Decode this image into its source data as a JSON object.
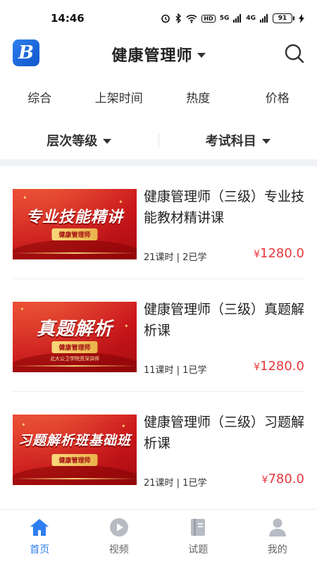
{
  "status_bar": {
    "time": "14:46",
    "hd_label": "HD",
    "signal_label_1": "5G",
    "signal_label_2": "4G",
    "battery_level": "91"
  },
  "header": {
    "logo_letter": "B",
    "title": "健康管理师"
  },
  "sort_tabs": [
    {
      "label": "综合"
    },
    {
      "label": "上架时间"
    },
    {
      "label": "热度"
    },
    {
      "label": "价格"
    }
  ],
  "filters": {
    "level": "层次等级",
    "subject": "考试科目"
  },
  "courses": [
    {
      "title": "健康管理师（三级）专业技能教材精讲课",
      "meta": "21课时 | 2已学",
      "price_symbol": "¥",
      "price": "1280.0",
      "thumb_title": "专业技能精讲",
      "thumb_tag": "健康管理师",
      "thumb_sub": ""
    },
    {
      "title": "健康管理师（三级）真题解析课",
      "meta": "11课时 | 1已学",
      "price_symbol": "¥",
      "price": "1280.0",
      "thumb_title": "真题解析",
      "thumb_tag": "健康管理师",
      "thumb_sub": "北大公卫学院资深讲师"
    },
    {
      "title": "健康管理师（三级）习题解析课",
      "meta": "21课时 | 1已学",
      "price_symbol": "¥",
      "price": "780.0",
      "thumb_title": "习题解析班基础班",
      "thumb_tag": "健康管理师",
      "thumb_sub": ""
    }
  ],
  "bottom_nav": [
    {
      "label": "首页",
      "icon": "home-icon",
      "active": true
    },
    {
      "label": "视频",
      "icon": "play-icon",
      "active": false
    },
    {
      "label": "试题",
      "icon": "book-icon",
      "active": false
    },
    {
      "label": "我的",
      "icon": "user-icon",
      "active": false
    }
  ],
  "colors": {
    "accent": "#2f7ff0",
    "price": "#e8383d",
    "banner_red": "#c8161b",
    "inactive_icon": "#b7bcc4"
  }
}
